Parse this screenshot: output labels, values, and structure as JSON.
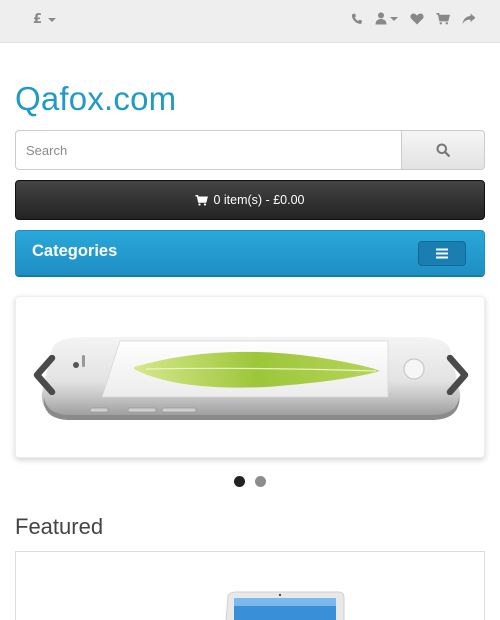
{
  "topbar": {
    "currency_symbol": "£",
    "icons": [
      "phone-icon",
      "user-icon",
      "heart-icon",
      "cart-icon",
      "share-icon"
    ]
  },
  "header": {
    "logo_text": "Qafox.com"
  },
  "search": {
    "placeholder": "Search"
  },
  "cart": {
    "label": "0 item(s) - £0.00"
  },
  "menu": {
    "categories_label": "Categories"
  },
  "slideshow": {
    "slide_count": 2,
    "active_index": 0
  },
  "featured": {
    "title": "Featured"
  },
  "colors": {
    "brand": "#229ac8",
    "categories_bg": "#229ac8",
    "cart_bg": "#303030",
    "topbar_bg": "#eeeeee"
  }
}
